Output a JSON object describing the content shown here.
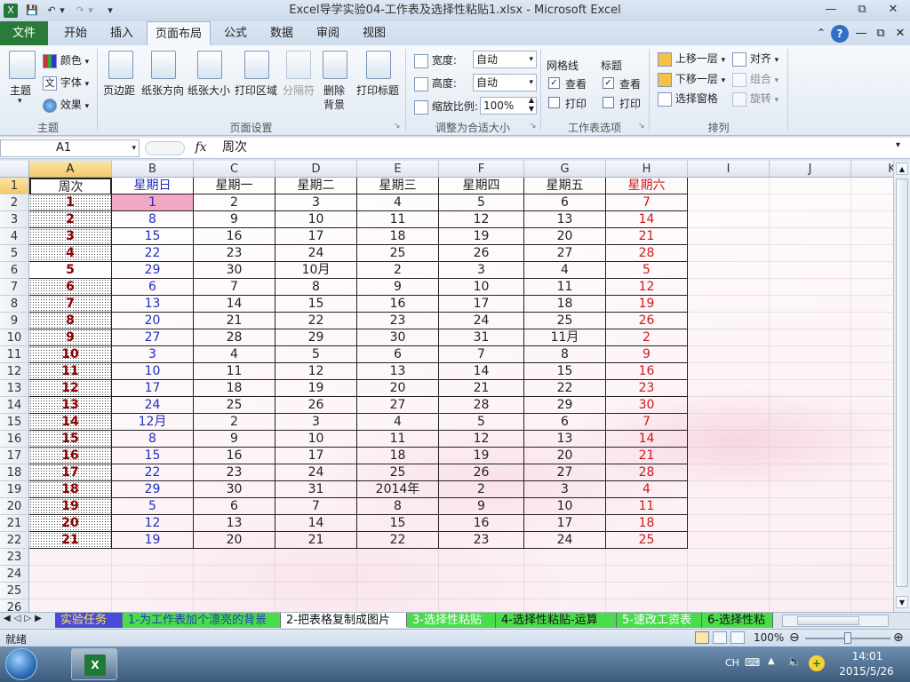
{
  "window": {
    "title": "Excel导学实验04-工作表及选择性粘贴1.xlsx - Microsoft Excel"
  },
  "tabs": [
    "文件",
    "开始",
    "插入",
    "页面布局",
    "公式",
    "数据",
    "审阅",
    "视图"
  ],
  "ribbon": {
    "theme_group": {
      "label": "主题",
      "theme": "主题",
      "colors": "颜色",
      "fonts": "字体",
      "effects": "效果"
    },
    "page_setup": {
      "label": "页面设置",
      "margins": "页边距",
      "orientation": "纸张方向",
      "size": "纸张大小",
      "print_area": "打印区域",
      "breaks": "分隔符",
      "delete_bg_1": "删除",
      "delete_bg_2": "背景",
      "print_titles": "打印标题"
    },
    "scale": {
      "label": "调整为合适大小",
      "width_label": "宽度:",
      "width_value": "自动",
      "height_label": "高度:",
      "height_value": "自动",
      "scale_label": "缩放比例:",
      "scale_value": "100%"
    },
    "sheet_options": {
      "label": "工作表选项",
      "gridlines": "网格线",
      "headings": "标题",
      "view": "查看",
      "print": "打印"
    },
    "arrange": {
      "label": "排列",
      "bring_forward": "上移一层",
      "send_backward": "下移一层",
      "selection_pane": "选择窗格",
      "align": "对齐",
      "group": "组合",
      "rotate": "旋转"
    }
  },
  "formula_bar": {
    "name_box": "A1",
    "fx": "fx",
    "content": "周次"
  },
  "columns": [
    "A",
    "B",
    "C",
    "D",
    "E",
    "F",
    "G",
    "H",
    "I",
    "J",
    "K"
  ],
  "rows": [
    "1",
    "2",
    "3",
    "4",
    "5",
    "6",
    "7",
    "8",
    "9",
    "10",
    "11",
    "12",
    "13",
    "14",
    "15",
    "16",
    "17",
    "18",
    "19",
    "20",
    "21",
    "22",
    "23",
    "24",
    "25",
    "26"
  ],
  "grid": [
    [
      "周次",
      "星期日",
      "星期一",
      "星期二",
      "星期三",
      "星期四",
      "星期五",
      "星期六"
    ],
    [
      "1",
      "1",
      "2",
      "3",
      "4",
      "5",
      "6",
      "7"
    ],
    [
      "2",
      "8",
      "9",
      "10",
      "11",
      "12",
      "13",
      "14"
    ],
    [
      "3",
      "15",
      "16",
      "17",
      "18",
      "19",
      "20",
      "21"
    ],
    [
      "4",
      "22",
      "23",
      "24",
      "25",
      "26",
      "27",
      "28"
    ],
    [
      "5",
      "29",
      "30",
      "10月",
      "2",
      "3",
      "4",
      "5"
    ],
    [
      "6",
      "6",
      "7",
      "8",
      "9",
      "10",
      "11",
      "12"
    ],
    [
      "7",
      "13",
      "14",
      "15",
      "16",
      "17",
      "18",
      "19"
    ],
    [
      "8",
      "20",
      "21",
      "22",
      "23",
      "24",
      "25",
      "26"
    ],
    [
      "9",
      "27",
      "28",
      "29",
      "30",
      "31",
      "11月",
      "2"
    ],
    [
      "10",
      "3",
      "4",
      "5",
      "6",
      "7",
      "8",
      "9"
    ],
    [
      "11",
      "10",
      "11",
      "12",
      "13",
      "14",
      "15",
      "16"
    ],
    [
      "12",
      "17",
      "18",
      "19",
      "20",
      "21",
      "22",
      "23"
    ],
    [
      "13",
      "24",
      "25",
      "26",
      "27",
      "28",
      "29",
      "30"
    ],
    [
      "14",
      "12月",
      "2",
      "3",
      "4",
      "5",
      "6",
      "7"
    ],
    [
      "15",
      "8",
      "9",
      "10",
      "11",
      "12",
      "13",
      "14"
    ],
    [
      "16",
      "15",
      "16",
      "17",
      "18",
      "19",
      "20",
      "21"
    ],
    [
      "17",
      "22",
      "23",
      "24",
      "25",
      "26",
      "27",
      "28"
    ],
    [
      "18",
      "29",
      "30",
      "31",
      "2014年",
      "2",
      "3",
      "4"
    ],
    [
      "19",
      "5",
      "6",
      "7",
      "8",
      "9",
      "10",
      "11"
    ],
    [
      "20",
      "12",
      "13",
      "14",
      "15",
      "16",
      "17",
      "18"
    ],
    [
      "21",
      "19",
      "20",
      "21",
      "22",
      "23",
      "24",
      "25"
    ]
  ],
  "sheet_tabs": [
    "实验任务",
    "1-为工作表加个漂亮的背景",
    "2-把表格复制成图片",
    "3-选择性粘贴",
    "4-选择性粘贴-运算",
    "5-速改工资表",
    "6-选择性粘"
  ],
  "status": {
    "ready": "就绪",
    "zoom": "100%"
  },
  "taskbar": {
    "lang": "CH",
    "time": "14:01",
    "date": "2015/5/26"
  },
  "colors": {
    "file_tab": "#2a7b3a",
    "week_red": "#8b0000",
    "sunday_blue": "#1f2fb8",
    "saturday_red": "#cc1a1a",
    "pink_cell": "#f2a7c5"
  }
}
